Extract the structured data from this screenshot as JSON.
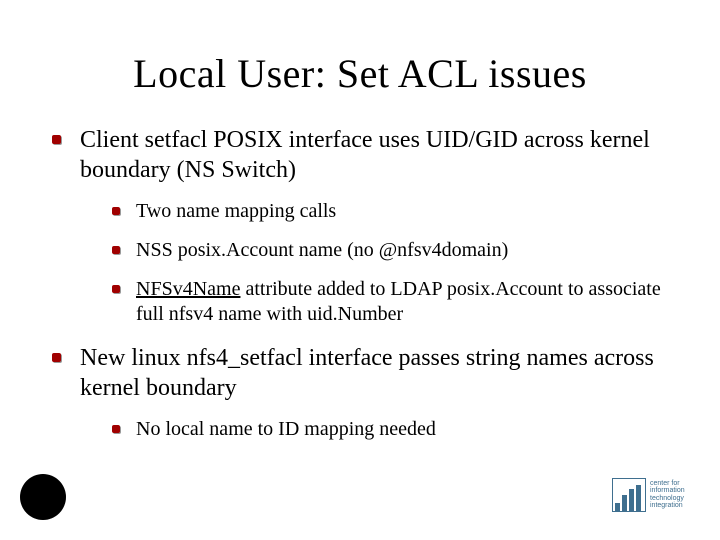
{
  "slide": {
    "title": "Local User: Set ACL issues",
    "bullets": [
      {
        "text": "Client setfacl POSIX interface uses UID/GID across kernel boundary (NS Switch)",
        "sub": [
          {
            "text": "Two name mapping calls"
          },
          {
            "text": "NSS posix.Account name (no @nfsv4domain)"
          },
          {
            "text_prefix_underlined": "NFSv4Name",
            "text_rest": " attribute added to LDAP posix.Account to associate full nfsv4 name with uid.Number"
          }
        ]
      },
      {
        "text": "New linux nfs4_setfacl interface passes string names across kernel boundary",
        "sub": [
          {
            "text": "No local name to ID mapping needed"
          }
        ]
      }
    ]
  },
  "footer": {
    "logo_text": "center for\ninformation\ntechnology\nintegration"
  }
}
